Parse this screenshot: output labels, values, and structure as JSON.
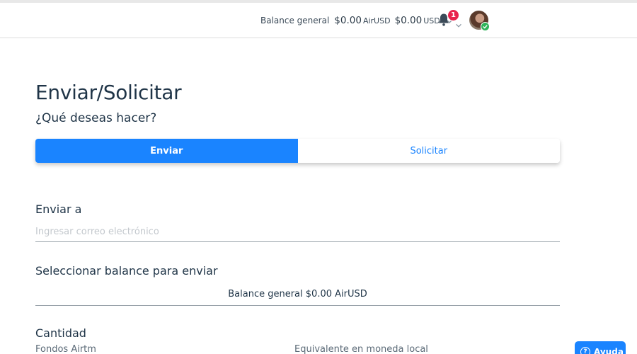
{
  "header": {
    "balance_label": "Balance general",
    "balance_amount_air": "$0.00",
    "balance_currency_air": "AirUSD",
    "balance_amount_usd": "$0.00",
    "balance_currency_usd": "USD",
    "notification_count": "1"
  },
  "main": {
    "title": "Enviar/Solicitar",
    "question": "¿Qué deseas hacer?",
    "tabs": [
      {
        "label": "Enviar",
        "active": true
      },
      {
        "label": "Solicitar",
        "active": false
      }
    ],
    "send_to_label": "Enviar a",
    "email_placeholder": "Ingresar correo electrónico",
    "select_balance_label": "Seleccionar balance para enviar",
    "selected_balance": "Balance general $0.00 AirUSD",
    "amount_label": "Cantidad",
    "funds_label": "Fondos Airtm",
    "local_equivalent_label": "Equivalente en moneda local"
  },
  "help": {
    "label": "Ayuda"
  },
  "colors": {
    "accent": "#1a84ff",
    "badge": "#e8224c",
    "verified": "#2fb45a",
    "text": "#1f3447"
  }
}
